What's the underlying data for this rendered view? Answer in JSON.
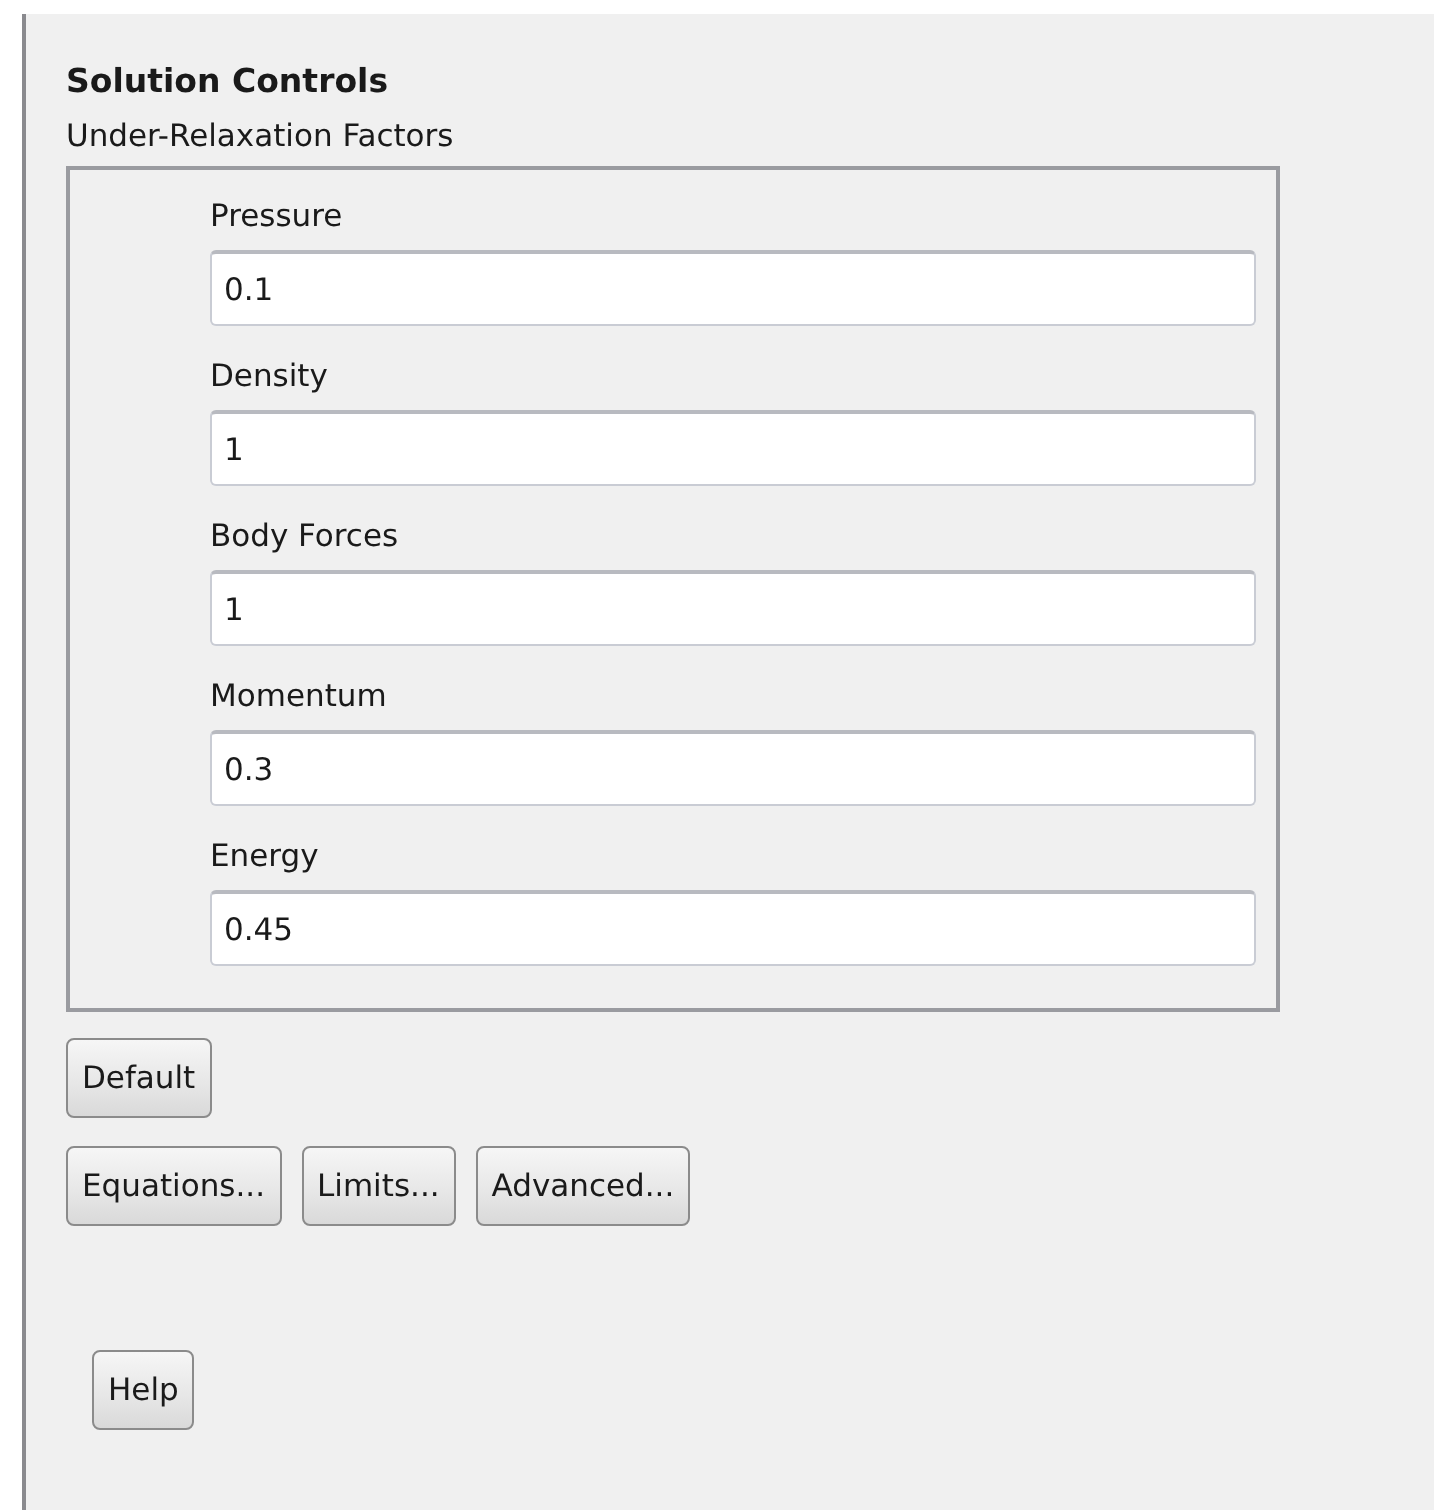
{
  "panel": {
    "title": "Solution Controls"
  },
  "group": {
    "label": "Under-Relaxation Factors",
    "factors": [
      {
        "label": "Pressure",
        "value": "0.1"
      },
      {
        "label": "Density",
        "value": "1"
      },
      {
        "label": "Body Forces",
        "value": "1"
      },
      {
        "label": "Momentum",
        "value": "0.3"
      },
      {
        "label": "Energy",
        "value": "0.45"
      }
    ]
  },
  "buttons": [
    {
      "label": "Default"
    }
  ],
  "more_buttons": [
    {
      "label": "Equations..."
    },
    {
      "label": "Limits..."
    },
    {
      "label": "Advanced..."
    }
  ],
  "help_button": {
    "label": "Help"
  }
}
